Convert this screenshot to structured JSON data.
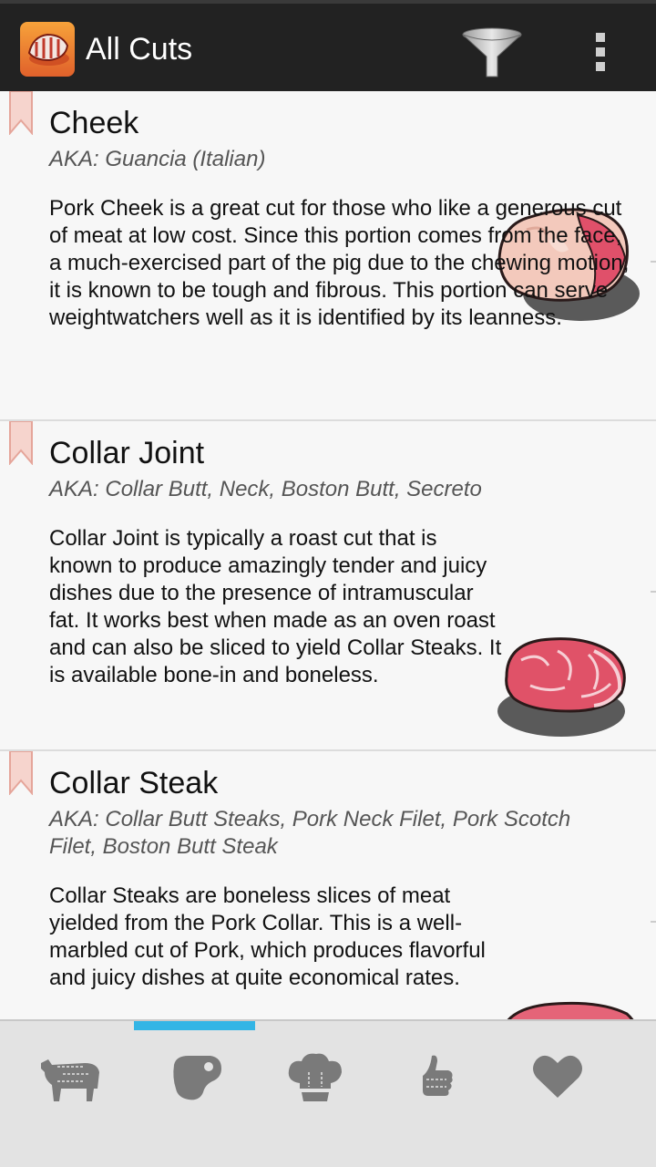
{
  "actionbar": {
    "title": "All Cuts",
    "app_icon": "steak-app-icon",
    "filter_icon": "funnel-icon",
    "overflow_icon": "overflow-menu-icon"
  },
  "cuts": [
    {
      "title": "Cheek",
      "aka": "AKA: Guancia (Italian)",
      "description": "Pork Cheek is a great cut for those who like a generous cut of meat at low cost. Since this portion comes from the face, a much-exercised part of the pig due to the chewing motion, it is known to be tough and fibrous. This portion can serve weightwatchers well as it is identified by its leanness.",
      "image_icon": "pork-cheek-icon"
    },
    {
      "title": "Collar Joint",
      "aka": "AKA: Collar Butt, Neck, Boston Butt, Secreto",
      "description": "Collar Joint is typically a roast cut that is known to produce amazingly tender and juicy dishes due to the presence of intramuscular fat. It works best when made as an oven roast and can also be sliced to yield Collar Steaks. It is available bone-in and boneless.",
      "image_icon": "collar-joint-icon"
    },
    {
      "title": "Collar Steak",
      "aka": "AKA: Collar Butt Steaks, Pork Neck Filet, Pork Scotch Filet, Boston Butt Steak",
      "description": "Collar Steaks are boneless slices of meat yielded from the Pork Collar. This is a well-marbled cut of Pork, which produces flavorful and juicy dishes at quite economical rates.",
      "image_icon": "collar-steak-icon"
    }
  ],
  "bottom_tabs": [
    {
      "icon": "animal-icon",
      "selected": false
    },
    {
      "icon": "meat-cut-icon",
      "selected": true
    },
    {
      "icon": "chef-hat-icon",
      "selected": false
    },
    {
      "icon": "thumbs-up-icon",
      "selected": false
    },
    {
      "icon": "heart-icon",
      "selected": false
    }
  ],
  "colors": {
    "actionbar": "#222222",
    "accent": "#33b5e5",
    "ribbon": "#f4c8c0",
    "tab_icon": "#7a7a7a"
  }
}
